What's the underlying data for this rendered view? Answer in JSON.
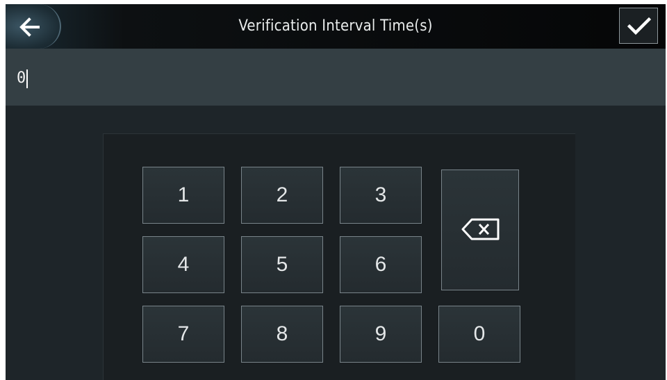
{
  "header": {
    "title": "Verification Interval Time(s)",
    "back_icon": "back-arrow-icon",
    "confirm_icon": "checkmark-icon"
  },
  "input": {
    "value": "0"
  },
  "keypad": {
    "keys": [
      "1",
      "2",
      "3",
      "4",
      "5",
      "6",
      "7",
      "8",
      "9",
      "0"
    ],
    "backspace_icon": "backspace-icon"
  },
  "colors": {
    "background": "#1e2529",
    "header_background": "#050607",
    "input_background": "#343f44",
    "key_border": "#79848a",
    "text": "#e4e7e8"
  }
}
